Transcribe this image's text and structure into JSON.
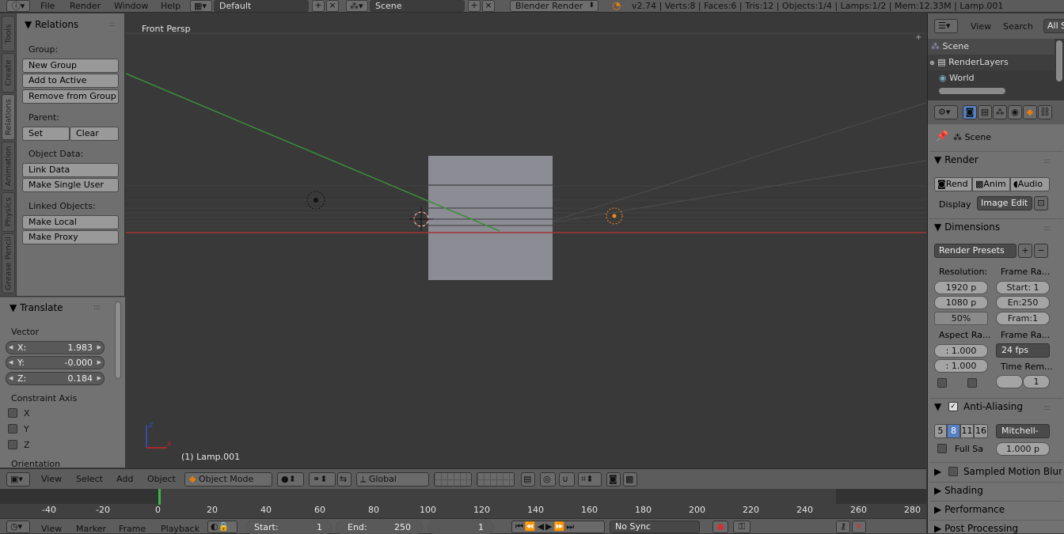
{
  "topbar": {
    "menus": [
      "File",
      "Render",
      "Window",
      "Help"
    ],
    "layout": "Default",
    "scene": "Scene",
    "engine": "Blender Render",
    "stats": "v2.74 | Verts:8 | Faces:6 | Tris:12 | Objects:1/4 | Lamps:1/2 | Mem:12.33M | Lamp.001"
  },
  "shelf_tabs": [
    "Tools",
    "Create",
    "Relations",
    "Animation",
    "Physics",
    "Grease Pencil"
  ],
  "relations": {
    "title": "Relations",
    "group_label": "Group:",
    "new_group": "New Group",
    "add_to_active": "Add to Active",
    "remove_from_group": "Remove from Group",
    "parent_label": "Parent:",
    "set": "Set",
    "clear": "Clear",
    "object_data_label": "Object Data:",
    "link_data": "Link Data",
    "make_single_user": "Make Single User",
    "linked_objects_label": "Linked Objects:",
    "make_local": "Make Local",
    "make_proxy": "Make Proxy"
  },
  "translate": {
    "title": "Translate",
    "vector_label": "Vector",
    "x_key": "X:",
    "x": "1.983",
    "y_key": "Y:",
    "y": "-0.000",
    "z_key": "Z:",
    "z": "0.184",
    "constraint_label": "Constraint Axis",
    "cx": "X",
    "cy": "Y",
    "cz": "Z",
    "orientation_label": "Orientation"
  },
  "viewport": {
    "view_name": "Front Persp",
    "active_object": "(1) Lamp.001"
  },
  "view_header": {
    "menus": [
      "View",
      "Select",
      "Add",
      "Object"
    ],
    "mode": "Object Mode",
    "orientation": "Global"
  },
  "timeline": {
    "ticks": [
      "-40",
      "-20",
      "0",
      "20",
      "40",
      "60",
      "80",
      "100",
      "120",
      "140",
      "160",
      "180",
      "200",
      "220",
      "240",
      "260",
      "280"
    ],
    "menus": [
      "View",
      "Marker",
      "Frame",
      "Playback"
    ],
    "start_label": "Start:",
    "start": "1",
    "end_label": "End:",
    "end": "250",
    "current": "1",
    "sync": "No Sync"
  },
  "outliner": {
    "menus": [
      "View",
      "Search"
    ],
    "filter": "All S",
    "items": [
      "Scene",
      "RenderLayers",
      "World"
    ]
  },
  "properties": {
    "context": "Scene",
    "render_title": "Render",
    "rend": "Rend",
    "anim": "Anim",
    "audio": "Audio",
    "display_label": "Display",
    "display": "Image Edit",
    "dimensions_title": "Dimensions",
    "render_presets": "Render Presets",
    "resolution_label": "Resolution:",
    "res_x": "1920 p",
    "res_y": "1080 p",
    "res_pct": "50%",
    "frame_range_label": "Frame Ra...",
    "start": "Start: 1",
    "end": "En:250",
    "frame": "Fram:1",
    "aspect_label": "Aspect Ra...",
    "aspect_x": ": 1.000",
    "aspect_y": ": 1.000",
    "frame_rate_label": "Frame Ra...",
    "fps": "24 fps",
    "time_remap_label": "Time Rem...",
    "time_remap": "1",
    "aa_title": "Anti-Aliasing",
    "aa_samples": [
      "5",
      "8",
      "11",
      "16"
    ],
    "aa_filter": "Mitchell-",
    "full_sample": "Full Sa",
    "filter_size": "1.000 p",
    "sampled_motion_blur": "Sampled Motion Blur",
    "shading": "Shading",
    "performance": "Performance",
    "post_processing": "Post Processing"
  },
  "colors": {
    "active_blue": "#5680c2",
    "x_axis": "#a33535",
    "y_axis": "#3b8c3b",
    "frame_marker": "#39b54a"
  }
}
